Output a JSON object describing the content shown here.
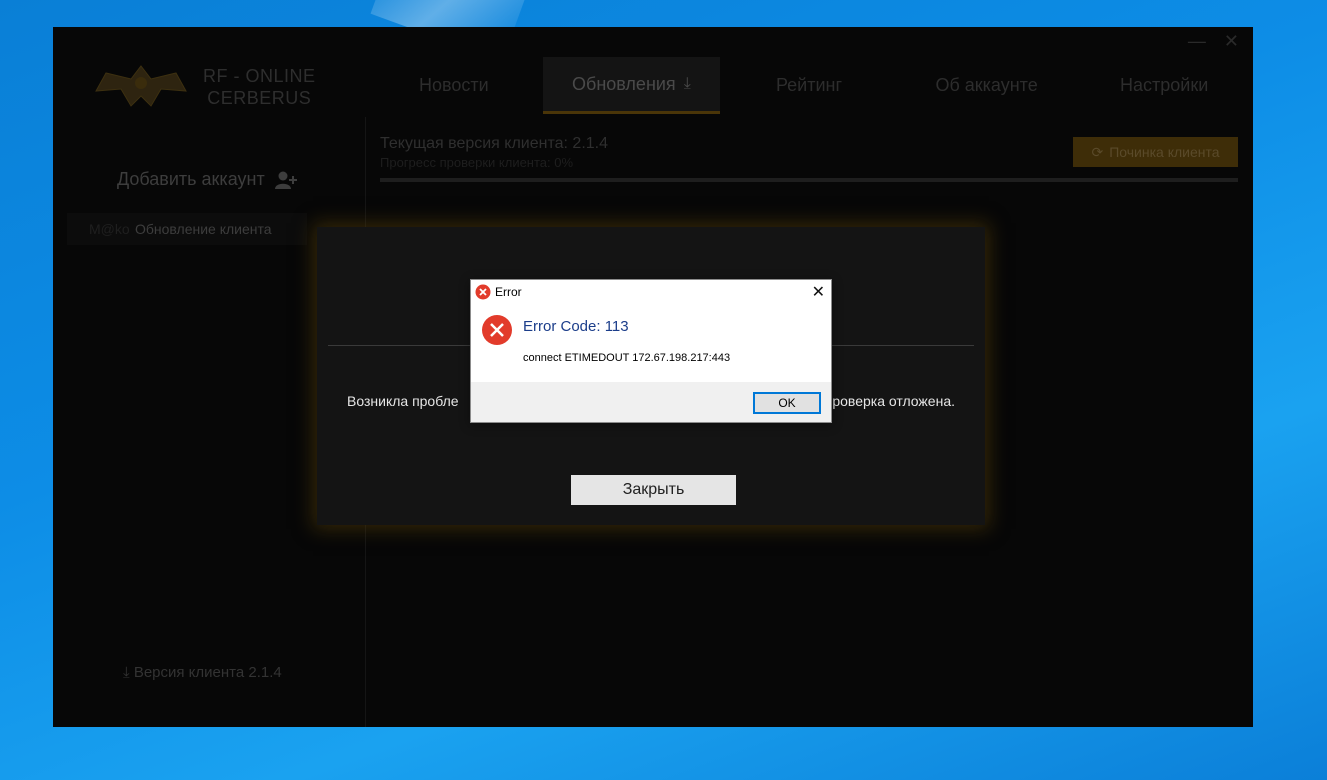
{
  "colors": {
    "desktop": "#0d8de6",
    "app_bg": "#070707",
    "accent": "#4a3508",
    "dialog_heading": "#1b3d8a",
    "ok_border": "#0078d7"
  },
  "window": {
    "minimize_icon": "minimize-icon",
    "close_icon": "close-icon",
    "minimize_glyph": "—",
    "close_glyph": "✕"
  },
  "brand": {
    "line1": "RF - ONLINE",
    "line2": "CERBERUS"
  },
  "tabs": [
    {
      "label": "Новости"
    },
    {
      "label": "Обновления",
      "icon": "download-icon",
      "icon_glyph": "⤓"
    },
    {
      "label": "Рейтинг"
    },
    {
      "label": "Об аккаунте"
    },
    {
      "label": "Настройки"
    }
  ],
  "sidebar": {
    "add_account": "Добавить аккаунт",
    "account_ghost": "M@ko",
    "account_label": "Обновление клиента",
    "version": "Версия клиента 2.1.4",
    "version_icon": "download-icon",
    "version_glyph": "⤓"
  },
  "main": {
    "current_version": "Текущая версия клиента: 2.1.4",
    "progress": "Прогресс проверки клиента: 0%",
    "progress_value": 0,
    "repair_label": "Починка клиента",
    "repair_icon": "refresh-icon",
    "repair_glyph": "⟳"
  },
  "modal": {
    "message_left": "Возникла пробле",
    "message_right": "роверка отложена.",
    "close_label": "Закрыть"
  },
  "dialog": {
    "title": "Error",
    "close_glyph": "✕",
    "heading": "Error Code: 113",
    "detail": "connect ETIMEDOUT 172.67.198.217:443",
    "ok_label": "OK"
  }
}
